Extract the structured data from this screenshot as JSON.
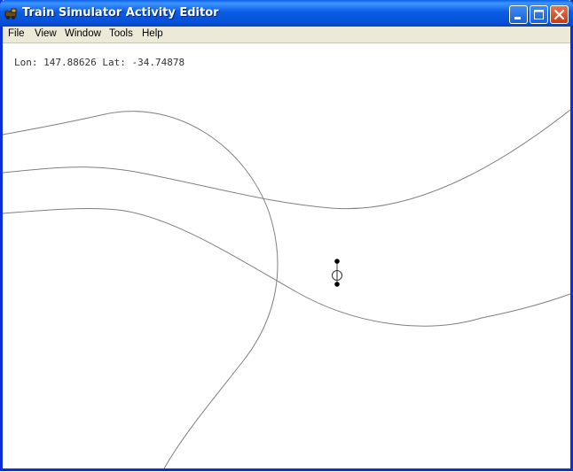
{
  "window": {
    "title": "Train Simulator Activity Editor",
    "title_bar_color": "#0a5ce4",
    "close_button_color": "#c8381c",
    "controls": [
      "minimize-icon",
      "maximize-icon",
      "close-icon"
    ]
  },
  "menu": {
    "file": "File",
    "view": "View",
    "window": "Window",
    "tools": "Tools",
    "help": "Help"
  },
  "map": {
    "lon_label": "Lon:",
    "lon_value": "147.88626",
    "lat_label": "Lat:",
    "lat_value": "-34.74878",
    "track_color": "#808080",
    "marker_icon": "train-marker-icon"
  }
}
